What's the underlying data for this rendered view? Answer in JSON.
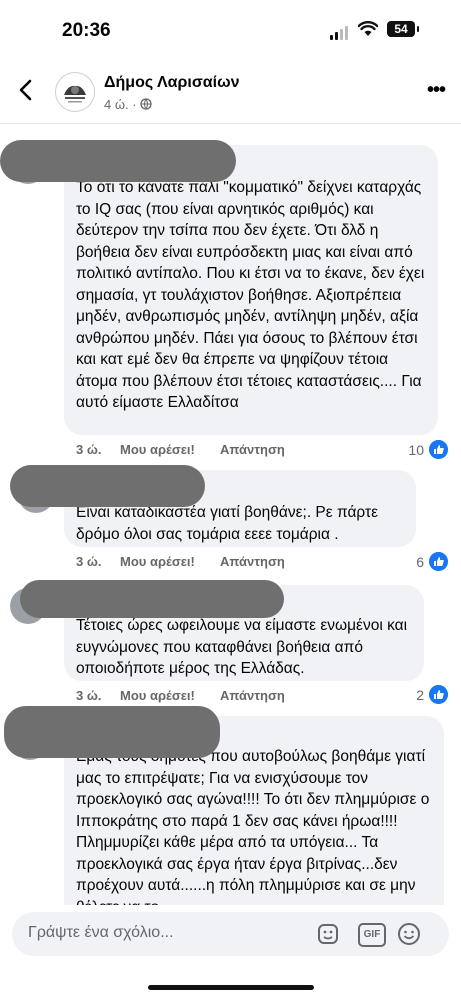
{
  "status_bar": {
    "time": "20:36",
    "battery": "54"
  },
  "header": {
    "page_name": "Δήμος Λαρισαίων",
    "post_age": "4 ώ.",
    "meta_separator": "·"
  },
  "comments": [
    {
      "text": "Το ότι το κάνατε πάλι \"κομματικό\" δείχνει καταρχάς το IQ σας (που είναι αρνητικός αριθμός) και δεύτερον την τσίπα που δεν έχετε. Ότι δλδ η βοήθεια δεν είναι ευπρόσδεκτη μιας και είναι από πολιτικό αντίπαλο. Που κι έτσι να το έκανε, δεν έχει σημασία, γτ τουλάχιστον βοήθησε. Αξιοπρέπεια μηδέν, ανθρωπισμός μηδέν, αντίληψη μηδέν, αξία ανθρώπου μηδέν. Πάει για όσους το βλέπουν έτσι και κατ εμέ δεν θα έπρεπε να ψηφίζουν τέτοια άτομα που βλέπουν έτσι τέτοιες καταστάσεις.... Για αυτό είμαστε Ελλαδίτσα",
      "time": "3 ώ.",
      "like_label": "Μου αρέσει!",
      "reply_label": "Απάντηση",
      "reactions": "10"
    },
    {
      "text": "Είναι καταδικαστέα γιατί βοηθάνε;. Ρε πάρτε δρόμο όλοι σας τομάρια εεεε τομάρια .",
      "time": "3 ώ.",
      "like_label": "Μου αρέσει!",
      "reply_label": "Απάντηση",
      "reactions": "6"
    },
    {
      "text": "Τέτοιες ώρες ωφειλουμε να είμαστε ενωμένοι και ευγνώμονες που καταφθάνει βοήθεια από οποιοδήποτε μέρος της Ελλάδας.",
      "time": "3 ώ.",
      "like_label": "Μου αρέσει!",
      "reply_label": "Απάντηση",
      "reactions": "2"
    },
    {
      "text": "Εμάς τους δημότες που αυτοβούλως βοηθάμε γιατί μας το επιτρέψατε; Για να ενισχύσουμε τον προεκλογικό σας αγώνα!!!! Το ότι δεν πλημμύρισε ο Ιπποκράτης στο παρά 1 δεν σας κάνει ήρωα!!!! Πλημμυρίζει κάθε μέρα από τα υπόγεια... Τα προεκλογικά σας έργα ήταν έργα βιτρίνας...δεν προέχουν αυτά......η πόλη πλημμύρισε και σε μην θέλετε να το"
    }
  ],
  "composer": {
    "placeholder": "Γράψτε ένα σχόλιο...",
    "gif_label": "GIF"
  },
  "colors": {
    "bubble": "#f0f2f5",
    "meta": "#65676b",
    "like_blue": "#1877f2",
    "redaction": "#6f6f6f"
  }
}
